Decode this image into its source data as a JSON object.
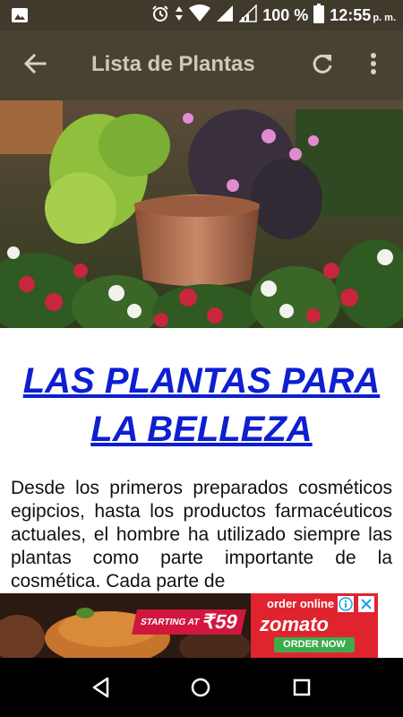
{
  "status_bar": {
    "battery_percent": "100 %",
    "time": "12:55",
    "time_suffix": "p. m.",
    "icons": [
      "image-icon",
      "alarm-icon",
      "data-transfer-icon",
      "wifi-icon",
      "signal-icon",
      "signal-icon-2",
      "battery-icon"
    ]
  },
  "app_bar": {
    "title": "Lista de Plantas",
    "back_icon": "arrow-back-icon",
    "refresh_icon": "refresh-icon",
    "menu_icon": "more-vert-icon"
  },
  "hero": {
    "alt": "flower-pot-garden-photo"
  },
  "article": {
    "title": "LAS PLANTAS PARA LA BELLEZA",
    "body": "Desde los primeros preparados cosméticos egipcios, hasta los productos farmacéuticos actuales, el hombre ha utilizado siempre las plantas como parte importante de la cosmética. Cada parte de"
  },
  "ad": {
    "starting_at": "STARTING AT",
    "price": "₹59",
    "order_online": "order online",
    "brand": "zomato",
    "order_now": "ORDER NOW"
  },
  "colors": {
    "status_bar_bg": "#3f3a2c",
    "app_bar_bg": "#4a4231",
    "title_link": "#0d1fd0",
    "ad_red": "#e0242f",
    "ad_green": "#3dab4a"
  }
}
